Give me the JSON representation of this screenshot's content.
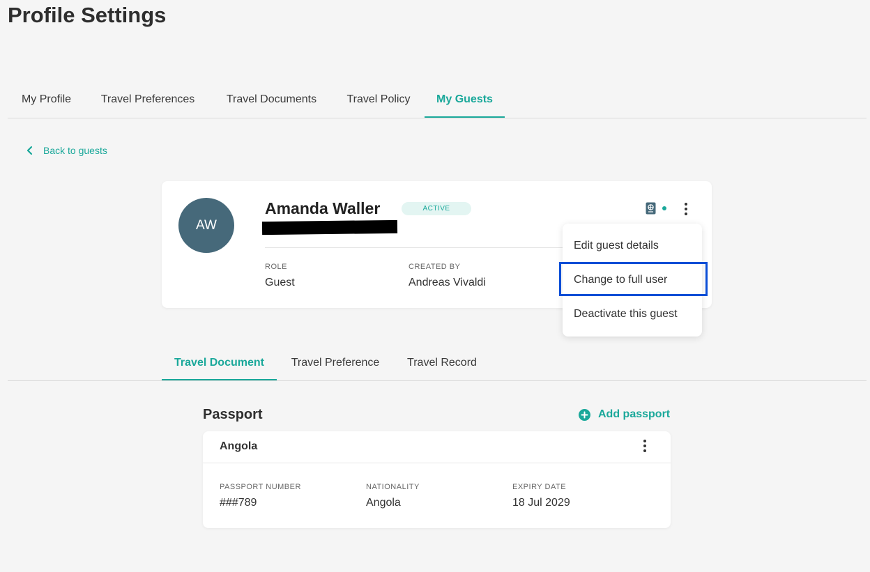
{
  "page": {
    "title": "Profile Settings"
  },
  "main_tabs": [
    {
      "label": "My Profile",
      "active": false
    },
    {
      "label": "Travel Preferences",
      "active": false
    },
    {
      "label": "Travel Documents",
      "active": false
    },
    {
      "label": "Travel Policy",
      "active": false
    },
    {
      "label": "My Guests",
      "active": true
    }
  ],
  "back_link": {
    "label": "Back to guests",
    "icon": "chevron-left-icon"
  },
  "guest": {
    "initials": "AW",
    "name": "Amanda Waller",
    "status": "ACTIVE",
    "role_label": "ROLE",
    "role_value": "Guest",
    "created_by_label": "CREATED BY",
    "created_by_value": "Andreas Vivaldi",
    "passport_icon": "passport-icon",
    "menu_icon": "more-vertical-icon"
  },
  "guest_menu": {
    "items": [
      {
        "label": "Edit guest details"
      },
      {
        "label": "Change to full user",
        "highlighted": true
      },
      {
        "label": "Deactivate this guest"
      }
    ]
  },
  "sub_tabs": [
    {
      "label": "Travel Document",
      "active": true
    },
    {
      "label": "Travel Preference",
      "active": false
    },
    {
      "label": "Travel Record",
      "active": false
    }
  ],
  "passport_section": {
    "title": "Passport",
    "add_label": "Add passport",
    "add_icon": "plus-circle-icon",
    "card": {
      "country": "Angola",
      "number_label": "PASSPORT NUMBER",
      "number_value": "###789",
      "nationality_label": "NATIONALITY",
      "nationality_value": "Angola",
      "expiry_label": "EXPIRY DATE",
      "expiry_value": "18 Jul 2029"
    }
  },
  "colors": {
    "accent": "#1aa89a",
    "avatar_bg": "#46697a",
    "highlight_border": "#0a4ed6",
    "background": "#f5f5f5"
  }
}
